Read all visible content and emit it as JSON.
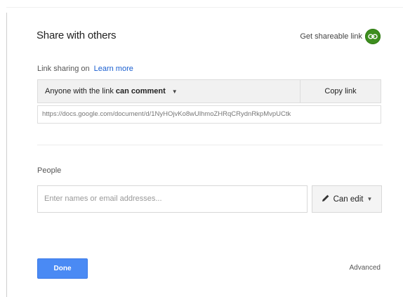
{
  "dialog": {
    "title": "Share with others",
    "get_link_label": "Get shareable link",
    "get_link_icon": "link-icon",
    "accent_green": "#3e8e1f"
  },
  "link_sharing": {
    "status_label": "Link sharing on",
    "learn_more": "Learn more",
    "access_prefix": "Anyone with the link",
    "access_level": "can comment",
    "copy_label": "Copy link",
    "url": "https://docs.google.com/document/d/1NyHOjvKo8wUlhmoZHRqCRydnRkpMvpUCtk"
  },
  "people": {
    "label": "People",
    "input_placeholder": "Enter names or email addresses...",
    "permission_label": "Can edit",
    "permission_icon": "pencil-icon"
  },
  "footer": {
    "done_label": "Done",
    "done_color": "#4a8af4",
    "advanced_label": "Advanced"
  }
}
